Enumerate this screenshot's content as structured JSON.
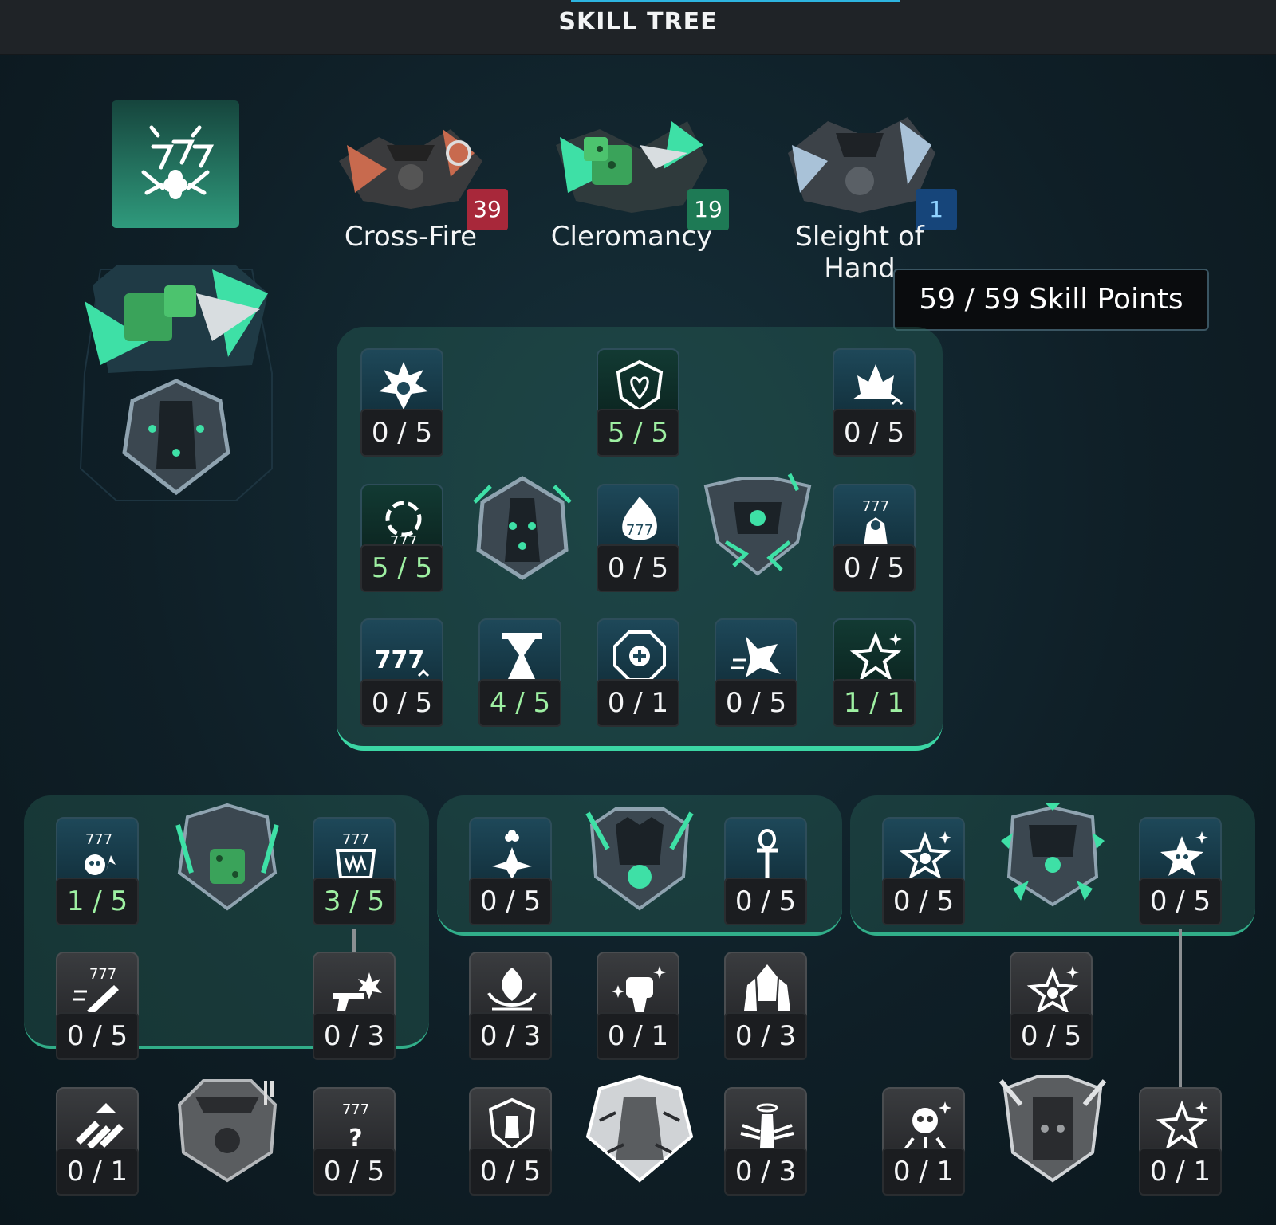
{
  "header": {
    "title": "SKILL TREE"
  },
  "colors": {
    "accent": "#2db4e0",
    "lit_count": "#9ef0a2",
    "panel_edge": "#3bd6a4",
    "badge_red": "#a8283a",
    "badge_green": "#1e7a55",
    "badge_blue": "#16457a"
  },
  "class_emblem": {
    "icon": "seven-seven-seven-clover-icon"
  },
  "specs": [
    {
      "name": "Cross-Fire",
      "points": "39",
      "icon": "cross-fire-spec-art"
    },
    {
      "name": "Cleromancy",
      "points": "19",
      "icon": "cleromancy-spec-art"
    },
    {
      "name": "Sleight of Hand",
      "points": "1",
      "icon": "sleight-of-hand-spec-art"
    }
  ],
  "skill_points": {
    "label": "59 / 59  Skill Points"
  },
  "main_tree": {
    "nodes": [
      {
        "count": "0 / 5",
        "icon": "clover-burst-icon"
      },
      {
        "count": "5 / 5",
        "icon": "heart-shield-icon"
      },
      {
        "count": "0 / 5",
        "icon": "flame-clover-up-icon"
      },
      {
        "count": "5 / 5",
        "icon": "spiral-777-icon"
      },
      {
        "count": "0 / 5",
        "icon": "fire-777-icon"
      },
      {
        "count": "0 / 5",
        "icon": "777-figure-icon"
      },
      {
        "count": "0 / 5",
        "icon": "777-up-icon"
      },
      {
        "count": "4 / 5",
        "icon": "hourglass-figure-icon"
      },
      {
        "count": "0 / 1",
        "icon": "medic-cross-icon"
      },
      {
        "count": "0 / 5",
        "icon": "dash-figure-icon"
      },
      {
        "count": "1 / 1",
        "icon": "sparkle-star-icon"
      }
    ],
    "capstones": [
      {
        "icon": "armor-capstone-icon"
      },
      {
        "icon": "lightning-armor-capstone-icon"
      }
    ]
  },
  "branches": {
    "left": {
      "nodes": [
        {
          "count": "1 / 5",
          "icon": "777-skull-icon"
        },
        {
          "count": "3 / 5",
          "icon": "777-fang-icon"
        },
        {
          "count": "0 / 5",
          "icon": "777-dagger-icon"
        },
        {
          "count": "0 / 3",
          "icon": "pistol-burst-icon"
        },
        {
          "count": "0 / 1",
          "icon": "bullets-icon"
        },
        {
          "count": "0 / 5",
          "icon": "777-question-icon"
        }
      ],
      "capstones": [
        {
          "icon": "dice-armor-capstone-icon"
        },
        {
          "icon": "gunslinger-capstone-icon"
        }
      ]
    },
    "middle": {
      "nodes": [
        {
          "count": "0 / 5",
          "icon": "clover-figure-icon"
        },
        {
          "count": "0 / 5",
          "icon": "ankh-icon"
        },
        {
          "count": "0 / 3",
          "icon": "lotus-figure-icon"
        },
        {
          "count": "0 / 1",
          "icon": "fist-sparkle-icon"
        },
        {
          "count": "0 / 3",
          "icon": "hooded-trio-icon"
        },
        {
          "count": "0 / 5",
          "icon": "shield-figure-icon"
        },
        {
          "count": "0 / 3",
          "icon": "halo-wings-icon"
        }
      ],
      "capstones": [
        {
          "icon": "triple-hood-capstone-icon"
        },
        {
          "icon": "shattered-figure-capstone-icon"
        }
      ]
    },
    "right": {
      "nodes": [
        {
          "count": "0 / 5",
          "icon": "sparkle-figure-icon"
        },
        {
          "count": "0 / 5",
          "icon": "sparkle-skull-icon"
        },
        {
          "count": "0 / 5",
          "icon": "sparkle-figure-icon"
        },
        {
          "count": "0 / 1",
          "icon": "skull-rays-icon"
        },
        {
          "count": "0 / 1",
          "icon": "sparkle-star-icon"
        }
      ],
      "capstones": [
        {
          "icon": "shard-armor-capstone-icon"
        },
        {
          "icon": "dark-armor-capstone-icon"
        }
      ]
    }
  }
}
